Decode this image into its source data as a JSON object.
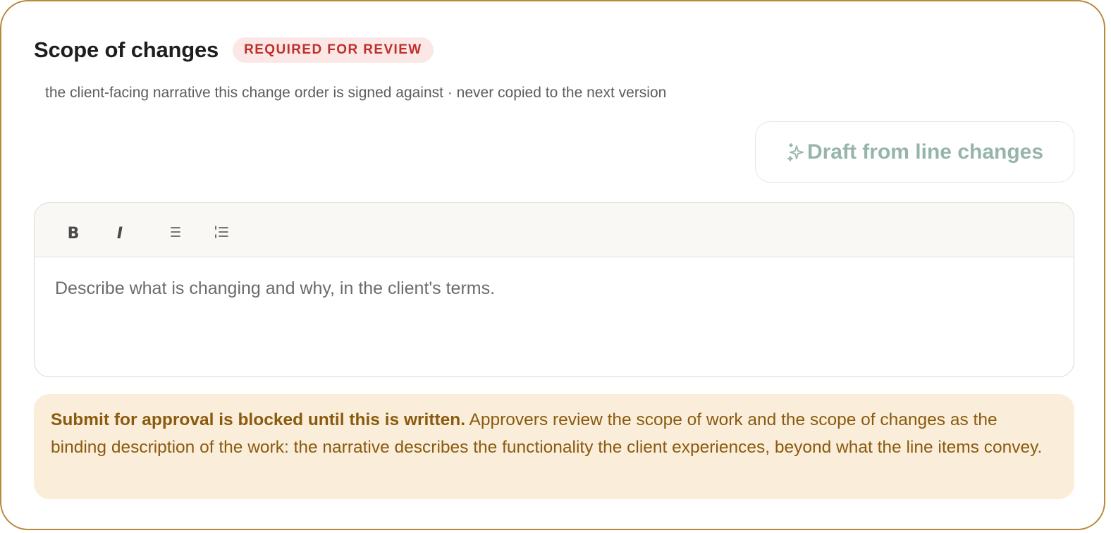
{
  "section": {
    "title": "Scope of changes",
    "badge": "REQUIRED FOR REVIEW",
    "subtitle": "the client-facing narrative this change order is signed against · never copied to the next version"
  },
  "draft_button": {
    "icon": "sparkle-icon",
    "label": "Draft from line changes"
  },
  "editor": {
    "toolbar": {
      "bold": "B",
      "italic": "I",
      "bullet_list_icon": "bullet-list-icon",
      "numbered_list_icon": "numbered-list-icon"
    },
    "placeholder": "Describe what is changing and why, in the client's terms."
  },
  "notice": {
    "bold_text": "Submit for approval is blocked until this is written.",
    "text": " Approvers review the scope of work and the scope of changes as the binding description of the work: the narrative describes the functionality the client experiences, beyond what the line items convey."
  },
  "colors": {
    "card_border": "#b8893a",
    "badge_bg": "#fbe7e6",
    "badge_text": "#bf2f2a",
    "draft_text": "#96b5a9",
    "notice_bg": "#faeedb",
    "notice_text": "#8a5a0e"
  }
}
